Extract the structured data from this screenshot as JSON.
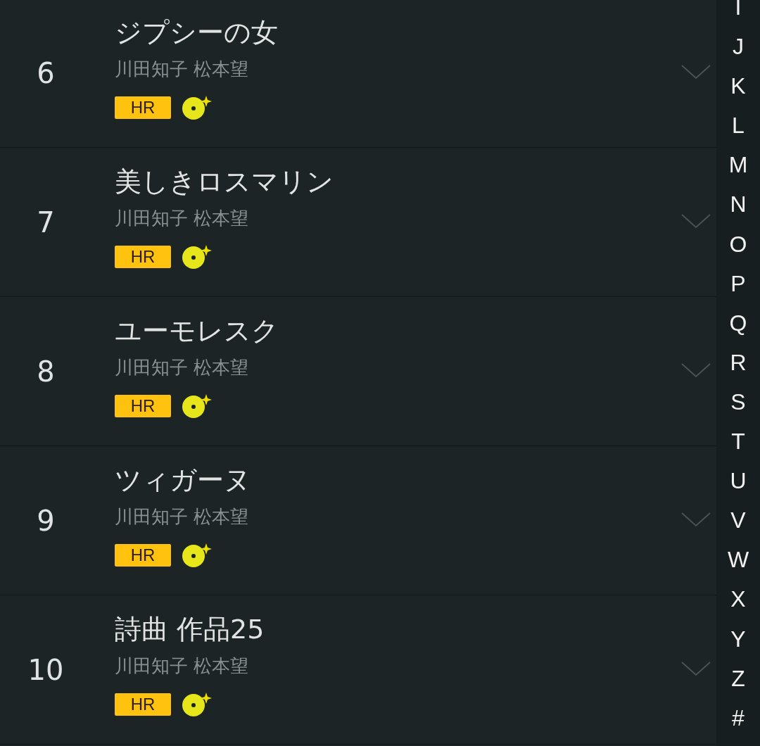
{
  "tracks": [
    {
      "number": "6",
      "title": "ジプシーの女",
      "artist": "川田知子 松本望",
      "badge": "HR"
    },
    {
      "number": "7",
      "title": "美しきロスマリン",
      "artist": "川田知子 松本望",
      "badge": "HR"
    },
    {
      "number": "8",
      "title": "ユーモレスク",
      "artist": "川田知子 松本望",
      "badge": "HR"
    },
    {
      "number": "9",
      "title": "ツィガーヌ",
      "artist": "川田知子 松本望",
      "badge": "HR"
    },
    {
      "number": "10",
      "title": "詩曲 作品25",
      "artist": "川田知子 松本望",
      "badge": "HR"
    }
  ],
  "index": [
    "I",
    "J",
    "K",
    "L",
    "M",
    "N",
    "O",
    "P",
    "Q",
    "R",
    "S",
    "T",
    "U",
    "V",
    "W",
    "X",
    "Y",
    "Z",
    "#"
  ]
}
